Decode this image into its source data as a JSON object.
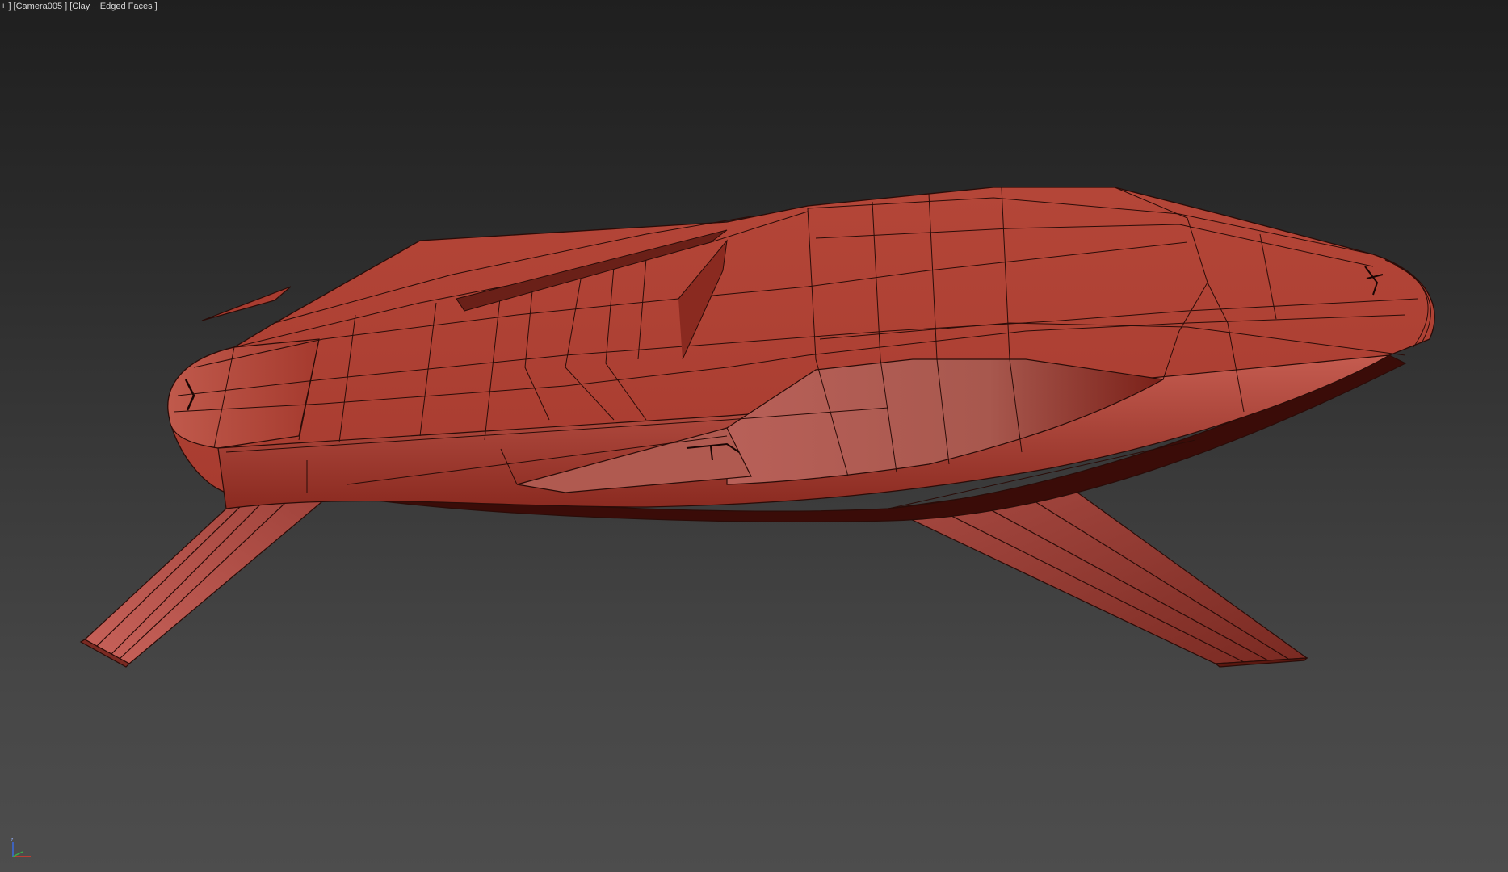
{
  "viewport": {
    "menu_plus": "+ ]",
    "camera": "[Camera005 ]",
    "shading": "[Clay + Edged Faces ]"
  },
  "axis_gizmo": {
    "z_label": "z"
  },
  "colors": {
    "clay": "#b84a3e",
    "clay_light": "#c8645a",
    "clay_dark": "#6a2018",
    "edge": "#2a0c08",
    "axis_x": "#e03a2a",
    "axis_y": "#3ab04a",
    "axis_z": "#3a6ae0"
  }
}
